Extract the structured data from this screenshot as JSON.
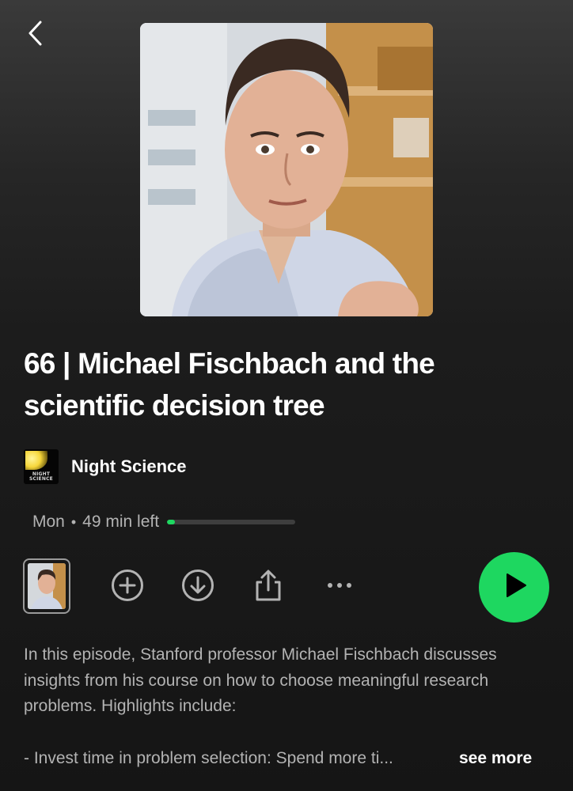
{
  "episode": {
    "title": "66 | Michael Fischbach and the scientific decision tree",
    "day": "Mon",
    "separator": "•",
    "time_left": "49 min left",
    "progress_fraction": 0.06
  },
  "show": {
    "name": "Night Science",
    "thumb_text": "NIGHT SCIENCE"
  },
  "actions": {
    "back_icon": "chevron-left-icon",
    "add_icon": "plus-circle-icon",
    "download_icon": "download-circle-icon",
    "share_icon": "share-icon",
    "more_icon": "more-horizontal-icon",
    "play_icon": "play-icon"
  },
  "description": {
    "paragraph": "In this episode, Stanford professor Michael Fischbach discusses insights from his course on how to choose meaningful research problems. Highlights include:",
    "truncated_line": "- Invest time in problem selection: Spend more ti...",
    "see_more": "see more"
  },
  "colors": {
    "accent": "#1ed760",
    "text_secondary": "#b3b3b3",
    "background": "#1c1c1c"
  }
}
